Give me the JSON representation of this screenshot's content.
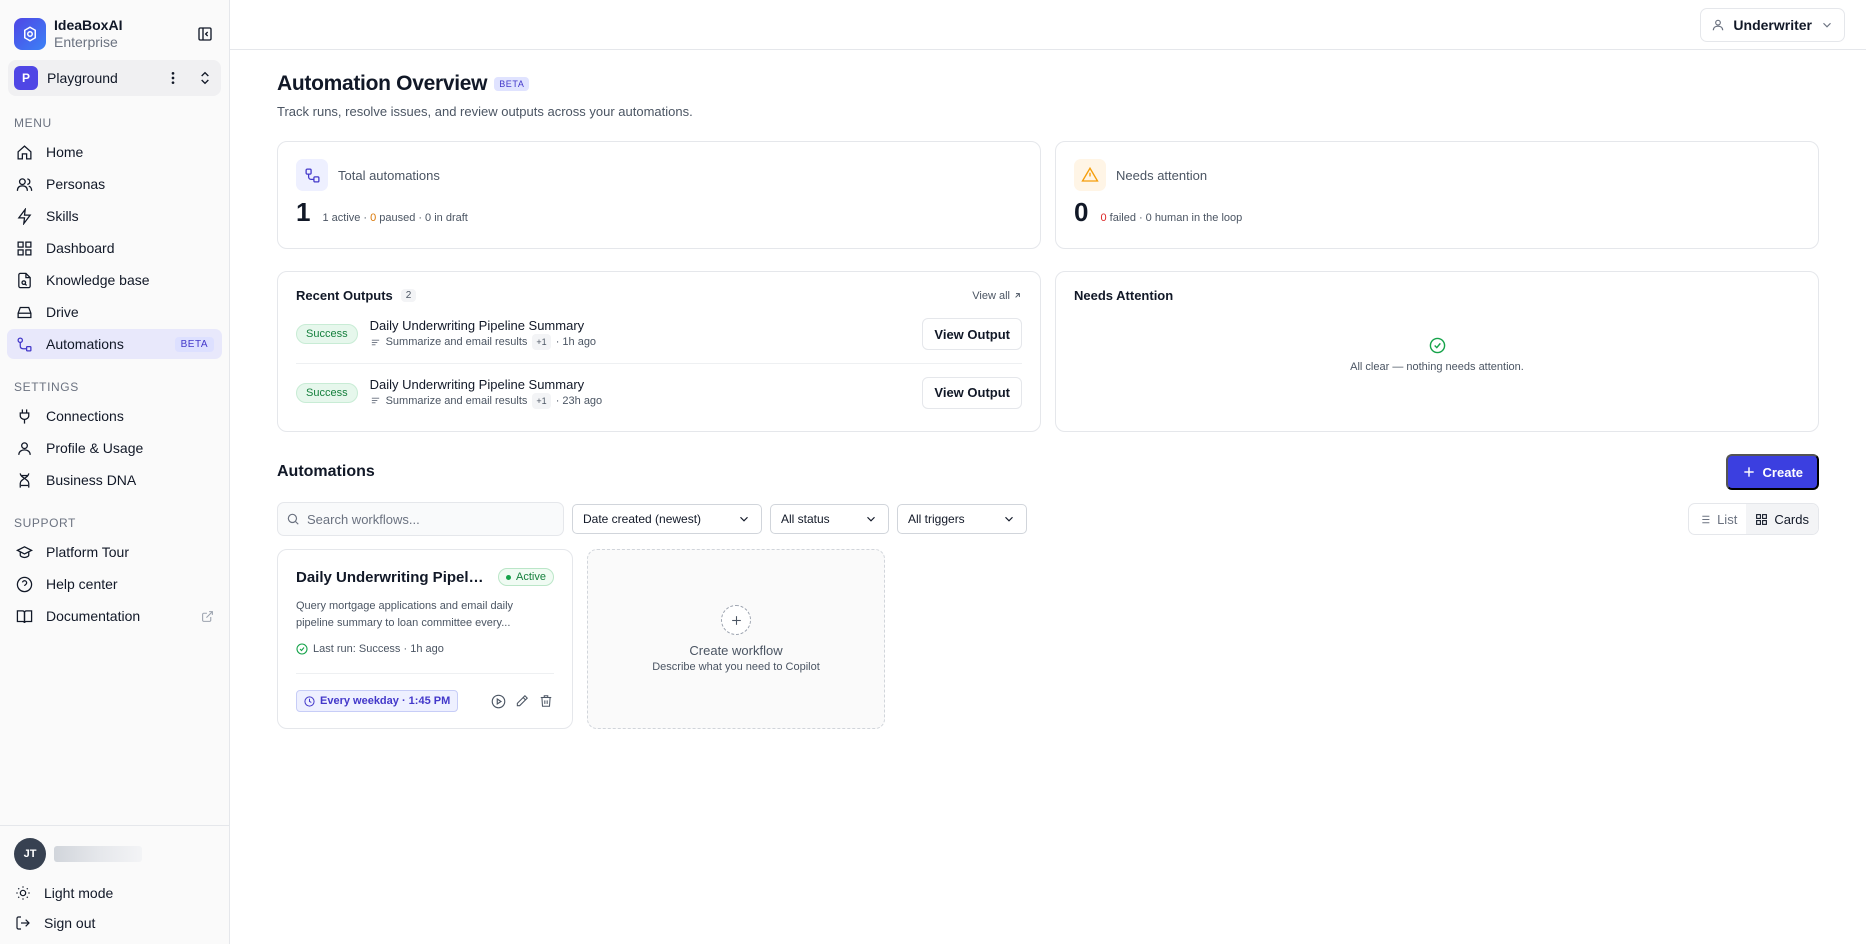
{
  "brand": {
    "name": "IdeaBoxAI",
    "plan": "Enterprise"
  },
  "workspace": {
    "initial": "P",
    "name": "Playground"
  },
  "menu": {
    "label": "MENU",
    "items": [
      {
        "label": "Home",
        "icon": "home-icon"
      },
      {
        "label": "Personas",
        "icon": "users-icon"
      },
      {
        "label": "Skills",
        "icon": "bolt-icon"
      },
      {
        "label": "Dashboard",
        "icon": "grid-icon"
      },
      {
        "label": "Knowledge base",
        "icon": "file-search-icon"
      },
      {
        "label": "Drive",
        "icon": "drive-icon"
      },
      {
        "label": "Automations",
        "icon": "workflow-icon",
        "badge": "BETA",
        "active": true
      }
    ]
  },
  "settings": {
    "label": "SETTINGS",
    "items": [
      {
        "label": "Connections",
        "icon": "plug-icon"
      },
      {
        "label": "Profile & Usage",
        "icon": "user-icon"
      },
      {
        "label": "Business DNA",
        "icon": "dna-icon"
      }
    ]
  },
  "support": {
    "label": "SUPPORT",
    "items": [
      {
        "label": "Platform Tour",
        "icon": "graduation-cap-icon"
      },
      {
        "label": "Help center",
        "icon": "help-circle-icon"
      },
      {
        "label": "Documentation",
        "icon": "book-icon"
      }
    ]
  },
  "user": {
    "initials": "JT"
  },
  "bottom": {
    "light_mode": "Light mode",
    "sign_out": "Sign out"
  },
  "topbar": {
    "role": "Underwriter"
  },
  "page": {
    "title": "Automation Overview",
    "badge": "BETA",
    "subtitle": "Track runs, resolve issues, and review outputs across your automations."
  },
  "stats": {
    "total": {
      "label": "Total automations",
      "value": "1",
      "active": "1",
      "active_label": "active",
      "paused": "0",
      "paused_label": "paused",
      "draft": "0",
      "draft_label": "in draft"
    },
    "attention": {
      "label": "Needs attention",
      "value": "0",
      "failed": "0",
      "failed_label": "failed",
      "hitl": "0",
      "hitl_label": "human in the loop"
    }
  },
  "recent_outputs": {
    "title": "Recent Outputs",
    "count": "2",
    "view_all": "View all",
    "items": [
      {
        "status": "Success",
        "title": "Daily Underwriting Pipeline Summary",
        "step": "Summarize and email results",
        "extra": "+1",
        "time": "· 1h ago",
        "button": "View Output"
      },
      {
        "status": "Success",
        "title": "Daily Underwriting Pipeline Summary",
        "step": "Summarize and email results",
        "extra": "+1",
        "time": "· 23h ago",
        "button": "View Output"
      }
    ]
  },
  "needs_attention": {
    "title": "Needs Attention",
    "empty_text": "All clear — nothing needs attention."
  },
  "automations": {
    "title": "Automations",
    "create_label": "Create",
    "search_placeholder": "Search workflows...",
    "filters": {
      "sort": "Date created (newest)",
      "status": "All status",
      "trigger": "All triggers"
    },
    "view": {
      "list": "List",
      "cards": "Cards",
      "selected": "cards"
    },
    "cards": [
      {
        "title": "Daily Underwriting Pipeline Summary",
        "status": "Active",
        "description": "Query mortgage applications and email daily pipeline summary to loan committee every...",
        "last_run": "Last run: Success · 1h ago",
        "schedule": "Every weekday · 1:45 PM"
      }
    ],
    "new_card": {
      "title": "Create workflow",
      "subtitle": "Describe what you need to Copilot"
    }
  },
  "colors": {
    "accent": "#3b3fe0",
    "success": "#15803d",
    "warning": "#d97706",
    "danger": "#dc2626"
  }
}
